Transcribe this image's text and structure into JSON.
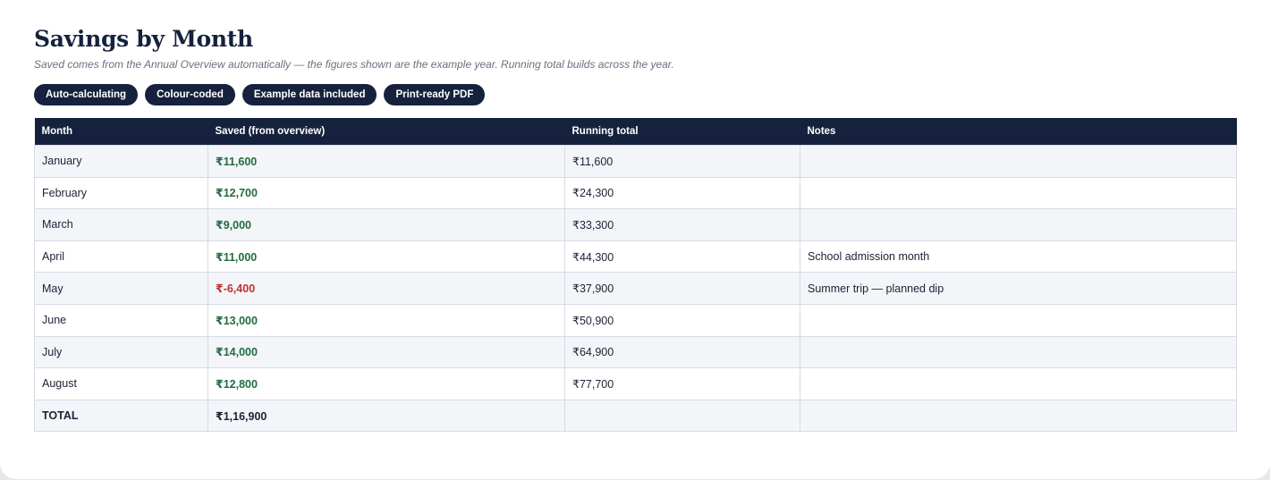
{
  "header": {
    "title": "Savings by Month",
    "subtitle": "Saved comes from the Annual Overview automatically — the figures shown are the example year. Running total builds across the year."
  },
  "badges": [
    {
      "label": "Auto-calculating"
    },
    {
      "label": "Colour-coded"
    },
    {
      "label": "Example data included"
    },
    {
      "label": "Print-ready PDF"
    }
  ],
  "table": {
    "columns": [
      "Month",
      "Saved (from overview)",
      "Running total",
      "Notes"
    ],
    "rows": [
      {
        "month": "January",
        "saved": "₹11,600",
        "running": "₹11,600",
        "notes": "",
        "negative": false
      },
      {
        "month": "February",
        "saved": "₹12,700",
        "running": "₹24,300",
        "notes": "",
        "negative": false
      },
      {
        "month": "March",
        "saved": "₹9,000",
        "running": "₹33,300",
        "notes": "",
        "negative": false
      },
      {
        "month": "April",
        "saved": "₹11,000",
        "running": "₹44,300",
        "notes": "School admission month",
        "negative": false
      },
      {
        "month": "May",
        "saved": "₹-6,400",
        "running": "₹37,900",
        "notes": "Summer trip — planned dip",
        "negative": true
      },
      {
        "month": "June",
        "saved": "₹13,000",
        "running": "₹50,900",
        "notes": "",
        "negative": false
      },
      {
        "month": "July",
        "saved": "₹14,000",
        "running": "₹64,900",
        "notes": "",
        "negative": false
      },
      {
        "month": "August",
        "saved": "₹12,800",
        "running": "₹77,700",
        "notes": "",
        "negative": false
      }
    ],
    "total": {
      "label": "TOTAL",
      "saved": "₹1,16,900",
      "running": "",
      "notes": ""
    }
  },
  "colors": {
    "navy": "#16223d",
    "positive": "#226b43",
    "negative": "#c0322d"
  }
}
